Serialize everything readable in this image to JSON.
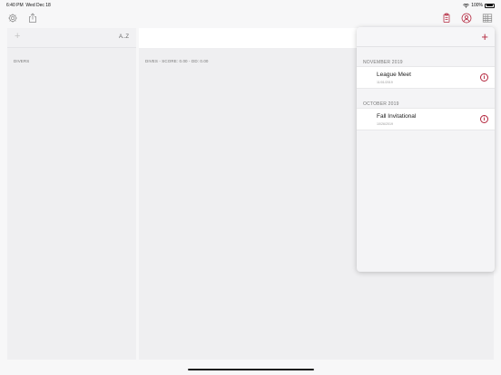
{
  "status_bar": {
    "time": "6:40 PM",
    "date": "Wed Dec 18",
    "battery": "100%"
  },
  "toolbar": {
    "settings_icon": "gear-icon",
    "share_icon": "share-icon",
    "meets_icon": "clipboard-icon",
    "profile_icon": "person-icon",
    "scoreboard_icon": "grid-table-icon"
  },
  "divers": {
    "add_symbol": "+",
    "sort_label": "A..Z",
    "section_label": "DIVERS"
  },
  "dives": {
    "section_label": "DIVES - SCORE: 0.00 - DD: 0.00"
  },
  "meets_popover": {
    "add_symbol": "+",
    "sections": [
      {
        "header": "NOVEMBER 2019",
        "meets": [
          {
            "name": "League Meet",
            "date": "11/01/2019"
          }
        ]
      },
      {
        "header": "OCTOBER 2019",
        "meets": [
          {
            "name": "Fall Invitational",
            "date": "10/26/2019"
          }
        ]
      }
    ],
    "info_symbol": "i"
  },
  "colors": {
    "accent": "#b3243b",
    "panel_bg": "#efeff1",
    "icon_grey": "#8a8a8a"
  }
}
